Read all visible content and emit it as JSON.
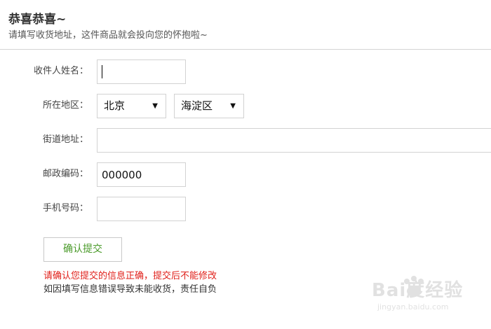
{
  "header": {
    "title": "恭喜恭喜~",
    "subtitle": "请填写收货地址，这件商品就会投向您的怀抱啦~"
  },
  "form": {
    "name_label": "收件人姓名：",
    "name_value": "",
    "region_label": "所在地区：",
    "city_selected": "北京",
    "district_selected": "海淀区",
    "street_label": "街道地址：",
    "street_value": "",
    "zip_label": "邮政编码：",
    "zip_value": "000000",
    "phone_label": "手机号码：",
    "phone_value": "",
    "select_arrow": "▼"
  },
  "actions": {
    "submit_label": "确认提交"
  },
  "notices": {
    "warning": "请确认您提交的信息正确，提交后不能修改",
    "note": "如因填写信息错误导致未能收货，责任自负"
  },
  "watermark": {
    "brand": "Bai度经验",
    "url": "jingyan.baidu.com"
  },
  "colors": {
    "warning": "#e0201a",
    "submit_text": "#4a9a2a",
    "border": "#d2d2d2"
  }
}
